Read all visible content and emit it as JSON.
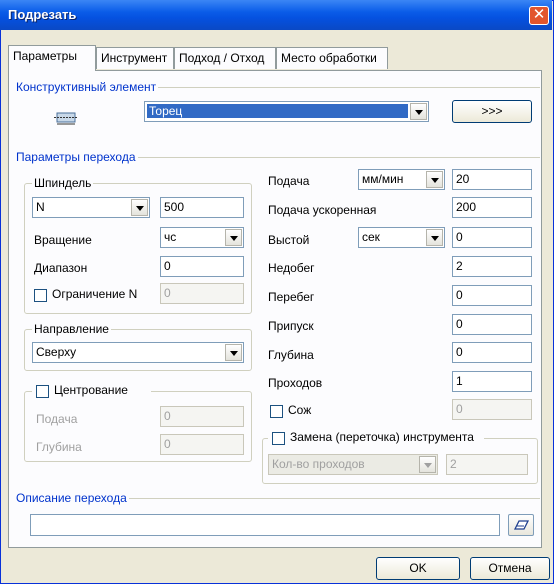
{
  "window": {
    "title": "Подрезать",
    "close_symbol": "✕"
  },
  "tabs": [
    "Параметры",
    "Инструмент",
    "Подход / Отход",
    "Место обработки"
  ],
  "element_section": {
    "title": "Конструктивный элемент",
    "combo_value": "Торец",
    "more_button": ">>>",
    "icon": "face-icon"
  },
  "transition_section": {
    "title": "Параметры перехода"
  },
  "spindle": {
    "title": "Шпиндель",
    "mode_value": "N",
    "speed_value": "500",
    "rotation_label": "Вращение",
    "rotation_value": "чс",
    "range_label": "Диапазон",
    "range_value": "0",
    "limit_label": "Ограничение N",
    "limit_value": "0",
    "limit_checked": false
  },
  "direction": {
    "title": "Направление",
    "value": "Сверху"
  },
  "centering": {
    "title": "Центрование",
    "checked": false,
    "feed_label": "Подача",
    "feed_value": "0",
    "depth_label": "Глубина",
    "depth_value": "0"
  },
  "right_params": {
    "feed_label": "Подача",
    "feed_unit": "мм/мин",
    "feed_value": "20",
    "rapid_label": "Подача ускоренная",
    "rapid_value": "200",
    "dwell_label": "Выстой",
    "dwell_unit": "сек",
    "dwell_value": "0",
    "underrun_label": "Недобег",
    "underrun_value": "2",
    "overrun_label": "Перебег",
    "overrun_value": "0",
    "allowance_label": "Припуск",
    "allowance_value": "0",
    "depth_label": "Глубина",
    "depth_value": "0",
    "passes_label": "Проходов",
    "passes_value": "1",
    "coolant_label": "Сож",
    "coolant_value": "0",
    "coolant_checked": false
  },
  "tool_change": {
    "title": "Замена (переточка) инструмента",
    "checked": false,
    "mode_value": "Кол-во проходов",
    "count_value": "2"
  },
  "description": {
    "title": "Описание перехода",
    "value": "",
    "edit_icon": "edit-icon"
  },
  "buttons": {
    "ok": "OK",
    "cancel": "Отмена"
  }
}
